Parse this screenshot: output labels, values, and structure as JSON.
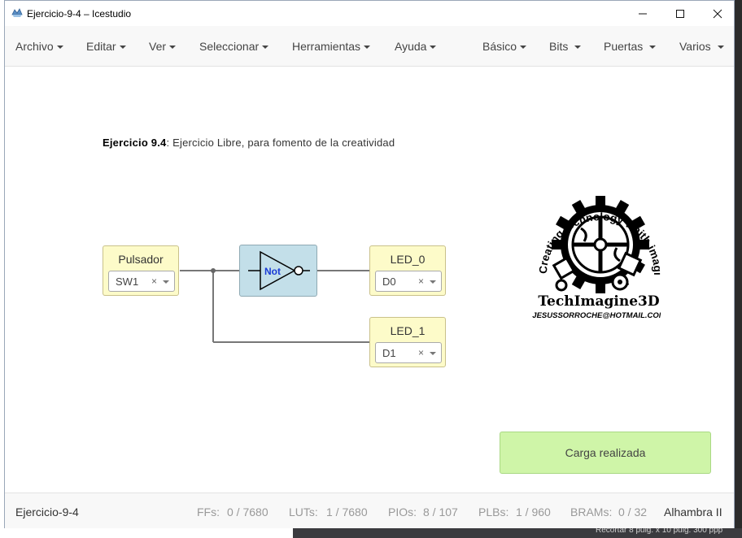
{
  "window": {
    "title": "Ejercicio-9-4 – Icestudio",
    "minimize": "—",
    "maximize": "☐",
    "close": "✕"
  },
  "menu_left": [
    "Archivo",
    "Editar",
    "Ver",
    "Seleccionar",
    "Herramientas",
    "Ayuda"
  ],
  "menu_right": [
    "Básico",
    "Bits",
    "Puertas",
    "Varios"
  ],
  "description": {
    "bold": "Ejercicio 9.4",
    "text": ": Ejercicio Libre, para fomento de la creatividad"
  },
  "blocks": {
    "input": {
      "label": "Pulsador",
      "value": "SW1",
      "clear": "×"
    },
    "gate": {
      "label": "Not"
    },
    "led0": {
      "label": "LED_0",
      "value": "D0",
      "clear": "×"
    },
    "led1": {
      "label": "LED_1",
      "value": "D1",
      "clear": "×"
    }
  },
  "logo": {
    "arc_text": "Creating technology whith imagination",
    "brand": "TechImagine3D",
    "email": "JESUSSORROCHE@HOTMAIL.COM"
  },
  "toast": "Carga realizada",
  "status": {
    "project": "Ejercicio-9-4",
    "ffs_label": "FFs:",
    "ffs_value": "0 / 7680",
    "luts_label": "LUTs:",
    "luts_value": "1 / 7680",
    "pios_label": "PIOs:",
    "pios_value": "8 / 107",
    "plbs_label": "PLBs:",
    "plbs_value": "1 / 960",
    "brams_label": "BRAMs:",
    "brams_value": "0 / 32",
    "board": "Alhambra II"
  },
  "background": {
    "bottom_right_text": "Recortar 8 pulg. x 10 pulg. 300 ppp"
  },
  "colors": {
    "io_block": "#fdfbc9",
    "gate_block": "#c3dfe9",
    "toast": "#cff5a8",
    "gate_label": "#1a3bd6"
  }
}
